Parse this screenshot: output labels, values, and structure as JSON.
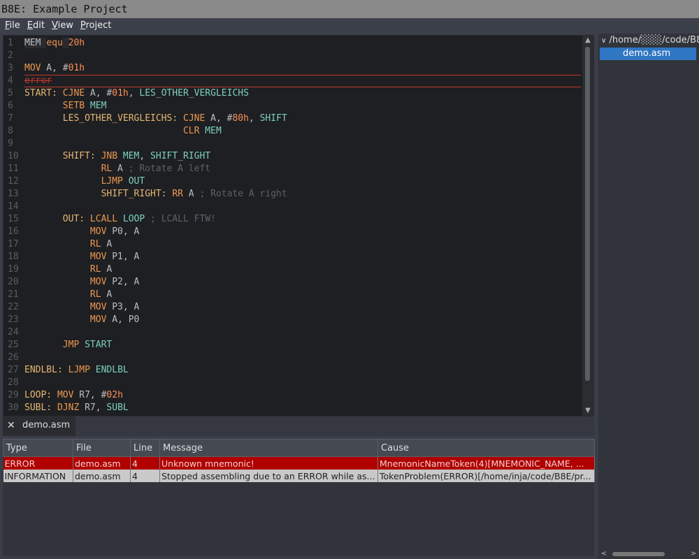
{
  "window": {
    "title": "B8E: Example Project"
  },
  "menu": [
    {
      "mnemonic": "F",
      "rest": "ile"
    },
    {
      "mnemonic": "E",
      "rest": "dit"
    },
    {
      "mnemonic": "V",
      "rest": "iew"
    },
    {
      "mnemonic": "P",
      "rest": "roject"
    }
  ],
  "editor": {
    "lines": [
      {
        "n": "1",
        "segs": [
          [
            "equ",
            "MEM "
          ],
          [
            "kw",
            "equ"
          ],
          [
            "equ",
            " "
          ],
          [
            "num",
            "20h"
          ]
        ]
      },
      {
        "n": "2",
        "segs": []
      },
      {
        "n": "3",
        "segs": [
          [
            "kw",
            "MOV"
          ],
          [
            "reg",
            " A, #"
          ],
          [
            "num",
            "01h"
          ]
        ]
      },
      {
        "n": "4",
        "segs": [
          [
            "err",
            "error"
          ]
        ],
        "error": true
      },
      {
        "n": "5",
        "segs": [
          [
            "lbl",
            "START:"
          ],
          [
            "kw",
            " CJNE"
          ],
          [
            "reg",
            " A, #"
          ],
          [
            "num",
            "01h"
          ],
          [
            "reg",
            ", "
          ],
          [
            "sym",
            "LES_OTHER_VERGLEICHS"
          ]
        ]
      },
      {
        "n": "6",
        "segs": [
          [
            "reg",
            "       "
          ],
          [
            "kw",
            "SETB"
          ],
          [
            "sym",
            " MEM"
          ]
        ]
      },
      {
        "n": "7",
        "segs": [
          [
            "reg",
            "       "
          ],
          [
            "lbl",
            "LES_OTHER_VERGLEICHS:"
          ],
          [
            "kw",
            " CJNE"
          ],
          [
            "reg",
            " A, #"
          ],
          [
            "num",
            "80h"
          ],
          [
            "reg",
            ", "
          ],
          [
            "sym",
            "SHIFT"
          ]
        ]
      },
      {
        "n": "8",
        "segs": [
          [
            "reg",
            "                             "
          ],
          [
            "kw",
            "CLR"
          ],
          [
            "sym",
            " MEM"
          ]
        ]
      },
      {
        "n": "9",
        "segs": []
      },
      {
        "n": "10",
        "segs": [
          [
            "reg",
            "       "
          ],
          [
            "lbl",
            "SHIFT:"
          ],
          [
            "kw",
            " JNB"
          ],
          [
            "sym",
            " MEM"
          ],
          [
            "reg",
            ", "
          ],
          [
            "sym",
            "SHIFT_RIGHT"
          ]
        ]
      },
      {
        "n": "11",
        "segs": [
          [
            "reg",
            "              "
          ],
          [
            "kw",
            "RL"
          ],
          [
            "reg",
            " A "
          ],
          [
            "cmt",
            "; Rotate A left"
          ]
        ]
      },
      {
        "n": "12",
        "segs": [
          [
            "reg",
            "              "
          ],
          [
            "kw",
            "LJMP"
          ],
          [
            "sym",
            " OUT"
          ]
        ]
      },
      {
        "n": "13",
        "segs": [
          [
            "reg",
            "              "
          ],
          [
            "lbl",
            "SHIFT_RIGHT:"
          ],
          [
            "kw",
            " RR"
          ],
          [
            "reg",
            " A "
          ],
          [
            "cmt",
            "; Rotate A right"
          ]
        ]
      },
      {
        "n": "14",
        "segs": []
      },
      {
        "n": "15",
        "segs": [
          [
            "reg",
            "       "
          ],
          [
            "lbl",
            "OUT:"
          ],
          [
            "kw",
            " LCALL"
          ],
          [
            "sym",
            " LOOP"
          ],
          [
            "reg",
            " "
          ],
          [
            "cmt",
            "; LCALL FTW!"
          ]
        ]
      },
      {
        "n": "16",
        "segs": [
          [
            "reg",
            "            "
          ],
          [
            "kw",
            "MOV"
          ],
          [
            "reg",
            " P0, A"
          ]
        ]
      },
      {
        "n": "17",
        "segs": [
          [
            "reg",
            "            "
          ],
          [
            "kw",
            "RL"
          ],
          [
            "reg",
            " A"
          ]
        ]
      },
      {
        "n": "18",
        "segs": [
          [
            "reg",
            "            "
          ],
          [
            "kw",
            "MOV"
          ],
          [
            "reg",
            " P1, A"
          ]
        ]
      },
      {
        "n": "19",
        "segs": [
          [
            "reg",
            "            "
          ],
          [
            "kw",
            "RL"
          ],
          [
            "reg",
            " A"
          ]
        ]
      },
      {
        "n": "20",
        "segs": [
          [
            "reg",
            "            "
          ],
          [
            "kw",
            "MOV"
          ],
          [
            "reg",
            " P2, A"
          ]
        ]
      },
      {
        "n": "21",
        "segs": [
          [
            "reg",
            "            "
          ],
          [
            "kw",
            "RL"
          ],
          [
            "reg",
            " A"
          ]
        ]
      },
      {
        "n": "22",
        "segs": [
          [
            "reg",
            "            "
          ],
          [
            "kw",
            "MOV"
          ],
          [
            "reg",
            " P3, A"
          ]
        ]
      },
      {
        "n": "23",
        "segs": [
          [
            "reg",
            "            "
          ],
          [
            "kw",
            "MOV"
          ],
          [
            "reg",
            " A, P0"
          ]
        ]
      },
      {
        "n": "24",
        "segs": []
      },
      {
        "n": "25",
        "segs": [
          [
            "reg",
            "       "
          ],
          [
            "kw",
            "JMP"
          ],
          [
            "sym",
            " START"
          ]
        ]
      },
      {
        "n": "26",
        "segs": []
      },
      {
        "n": "27",
        "segs": [
          [
            "lbl",
            "ENDLBL:"
          ],
          [
            "kw",
            " LJMP"
          ],
          [
            "sym",
            " ENDLBL"
          ]
        ]
      },
      {
        "n": "28",
        "segs": []
      },
      {
        "n": "29",
        "segs": [
          [
            "lbl",
            "LOOP:"
          ],
          [
            "kw",
            " MOV"
          ],
          [
            "reg",
            " R7, #"
          ],
          [
            "num",
            "02h"
          ]
        ]
      },
      {
        "n": "30",
        "segs": [
          [
            "lbl",
            "SUBL:"
          ],
          [
            "kw",
            " DJNZ"
          ],
          [
            "reg",
            " R7, "
          ],
          [
            "sym",
            "SUBL"
          ]
        ]
      }
    ]
  },
  "tab": {
    "label": "demo.asm",
    "close_icon": "close-icon"
  },
  "problems": {
    "columns": [
      "Type",
      "File",
      "Line",
      "Message",
      "Cause"
    ],
    "rows": [
      {
        "severity": "error",
        "cells": [
          "ERROR",
          "demo.asm",
          "4",
          "Unknown mnemonic!",
          "MnemonicNameToken(4)[MNEMONIC_NAME, ..."
        ]
      },
      {
        "severity": "info",
        "cells": [
          "INFORMATION",
          "demo.asm",
          "4",
          "Stopped assembling due to an ERROR while as...",
          "TokenProblem(ERROR)[/home/inja/code/B8E/pr..."
        ]
      }
    ]
  },
  "project_tree": {
    "root": "/home/░░░/code/B8E",
    "files": [
      "demo.asm"
    ]
  },
  "colors": {
    "selection": "#2f76c3",
    "error_row": "#b00000",
    "info_row": "#c9c9c9"
  }
}
